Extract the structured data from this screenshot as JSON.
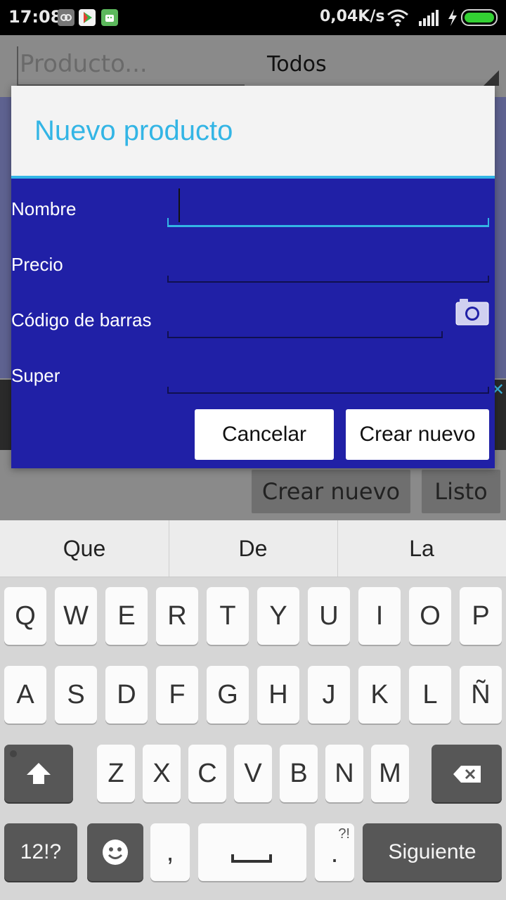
{
  "status_bar": {
    "time": "17:08",
    "net_speed": "0,04K/s",
    "icons": [
      "app-notification-icon",
      "play-store-icon",
      "android-debug-icon",
      "wifi-icon",
      "signal-icon",
      "charging-icon",
      "battery-icon"
    ]
  },
  "background": {
    "search_placeholder": "Producto...",
    "filter_selected": "Todos",
    "create_button": "Crear nuevo",
    "done_button": "Listo"
  },
  "dialog": {
    "title": "Nuevo producto",
    "fields": {
      "name": {
        "label": "Nombre",
        "value": ""
      },
      "price": {
        "label": "Precio",
        "value": ""
      },
      "barcode": {
        "label": "Código de barras",
        "value": ""
      },
      "store": {
        "label": "Super",
        "value": ""
      }
    },
    "cancel_button": "Cancelar",
    "create_button": "Crear nuevo"
  },
  "keyboard": {
    "suggestions": [
      "Que",
      "De",
      "La"
    ],
    "row1": [
      "Q",
      "W",
      "E",
      "R",
      "T",
      "Y",
      "U",
      "I",
      "O",
      "P"
    ],
    "row2": [
      "A",
      "S",
      "D",
      "F",
      "G",
      "H",
      "J",
      "K",
      "L",
      "Ñ"
    ],
    "row3": [
      "Z",
      "X",
      "C",
      "V",
      "B",
      "N",
      "M"
    ],
    "symbols_key": "12!?",
    "comma_key": ",",
    "period_key": ".",
    "period_hint": "?!",
    "action_key": "Siguiente"
  },
  "colors": {
    "accent": "#33b5e5",
    "dialog_body": "#2020a6",
    "dialog_header": "#f3f3f3"
  }
}
